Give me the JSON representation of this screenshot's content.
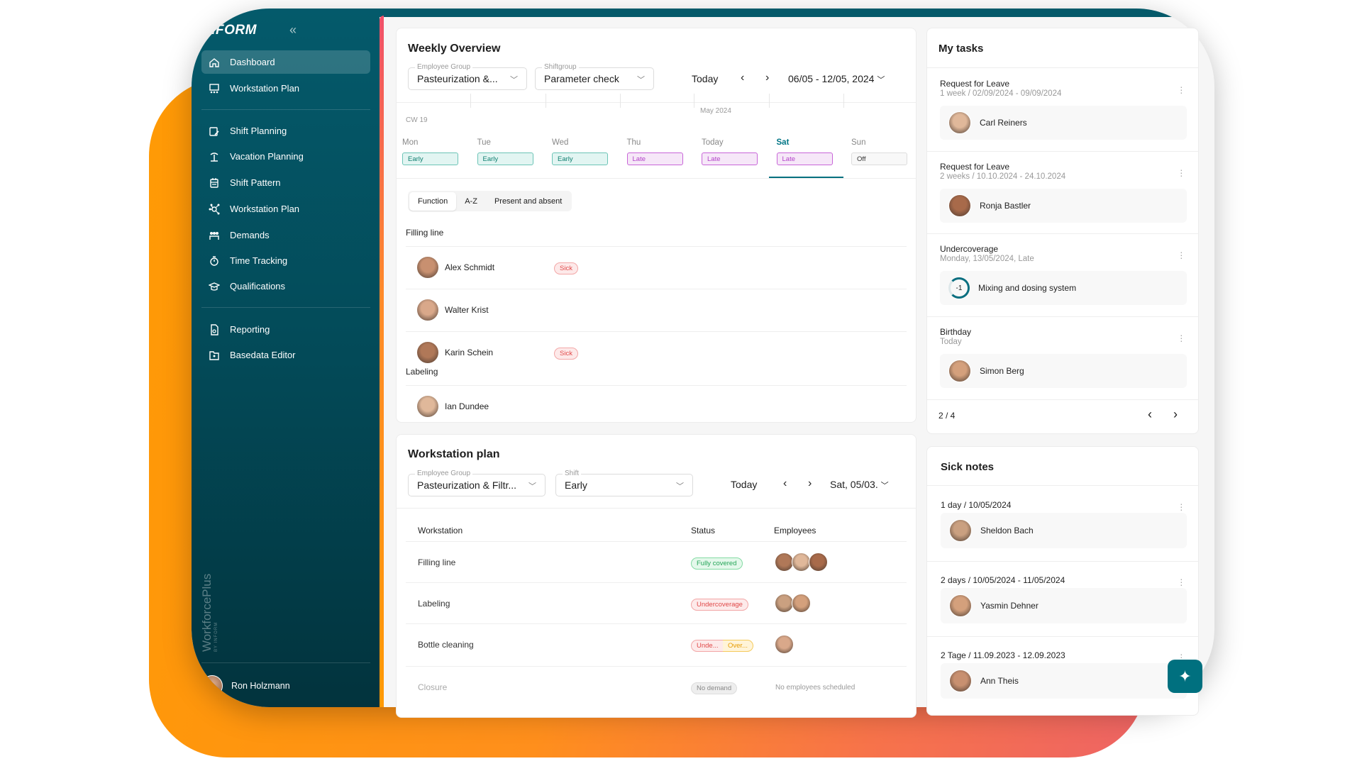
{
  "app": {
    "logo": "INFORM",
    "brand": "WorkforcePlus",
    "brand_sub": "BY INFORM"
  },
  "sidebar": {
    "items": [
      {
        "label": "Dashboard",
        "icon": "home-icon",
        "active": true
      },
      {
        "label": "Workstation Plan",
        "icon": "workstation-icon"
      },
      {
        "label": "Shift Planning",
        "icon": "calendar-edit-icon"
      },
      {
        "label": "Vacation Planning",
        "icon": "palm-tree-icon"
      },
      {
        "label": "Shift Pattern",
        "icon": "calendar-icon"
      },
      {
        "label": "Workstation Plan",
        "icon": "network-icon"
      },
      {
        "label": "Demands",
        "icon": "people-icon"
      },
      {
        "label": "Time Tracking",
        "icon": "stopwatch-icon"
      },
      {
        "label": "Qualifications",
        "icon": "graduation-cap-icon"
      },
      {
        "label": "Reporting",
        "icon": "report-icon"
      },
      {
        "label": "Basedata Editor",
        "icon": "folder-icon"
      }
    ],
    "user": "Ron Holzmann"
  },
  "weekly": {
    "title": "Weekly Overview",
    "employee_group": {
      "label": "Employee Group",
      "value": "Pasteurization &..."
    },
    "shiftgroup": {
      "label": "Shiftgroup",
      "value": "Parameter check"
    },
    "today": "Today",
    "range": "06/05 - 12/05, 2024",
    "cw": "CW 19",
    "month": "May 2024",
    "days": [
      {
        "name": "Mon",
        "shift": "Early",
        "type": "early"
      },
      {
        "name": "Tue",
        "shift": "Early",
        "type": "early"
      },
      {
        "name": "Wed",
        "shift": "Early",
        "type": "early"
      },
      {
        "name": "Thu",
        "shift": "Late",
        "type": "late"
      },
      {
        "name": "Today",
        "shift": "Late",
        "type": "late"
      },
      {
        "name": "Sat",
        "shift": "Late",
        "type": "late",
        "selected": true
      },
      {
        "name": "Sun",
        "shift": "Off",
        "type": "off"
      }
    ],
    "sort": [
      "Function",
      "A-Z",
      "Present and absent"
    ],
    "sections": [
      {
        "name": "Filling line",
        "people": [
          {
            "name": "Alex Schmidt",
            "badge": "Sick"
          },
          {
            "name": "Walter Krist"
          },
          {
            "name": "Karin Schein",
            "badge": "Sick"
          }
        ]
      },
      {
        "name": "Labeling",
        "people": [
          {
            "name": "Ian Dundee"
          }
        ]
      }
    ]
  },
  "workstation": {
    "title": "Workstation plan",
    "employee_group": {
      "label": "Employee Group",
      "value": "Pasteurization & Filtr..."
    },
    "shift": {
      "label": "Shift",
      "value": "Early"
    },
    "today": "Today",
    "date": "Sat, 05/03.",
    "headers": [
      "Workstation",
      "Status",
      "Employees"
    ],
    "rows": [
      {
        "name": "Filling line",
        "status": [
          {
            "text": "Fully covered",
            "type": "full"
          }
        ],
        "employees": 3
      },
      {
        "name": "Labeling",
        "status": [
          {
            "text": "Undercoverage",
            "type": "under"
          }
        ],
        "employees": 2
      },
      {
        "name": "Bottle cleaning",
        "status": [
          {
            "text": "Unde...",
            "type": "under"
          },
          {
            "text": "Over...",
            "type": "over"
          }
        ],
        "employees": 1
      },
      {
        "name": "Closure",
        "status": [
          {
            "text": "No demand",
            "type": "nod"
          }
        ],
        "employees": 0,
        "note": "No employees scheduled"
      }
    ]
  },
  "tasks": {
    "title": "My tasks",
    "items": [
      {
        "title": "Request for Leave",
        "sub": "1 week / 02/09/2024 - 09/09/2024",
        "person": "Carl Reiners"
      },
      {
        "title": "Request for Leave",
        "sub": "2 weeks / 10.10.2024 - 24.10.2024",
        "person": "Ronja Bastler"
      },
      {
        "title": "Undercoverage",
        "sub": "Monday, 13/05/2024, Late",
        "person": "Mixing and dosing system",
        "gauge": "-1"
      },
      {
        "title": "Birthday",
        "sub": "Today",
        "person": "Simon Berg"
      }
    ],
    "pager": "2 / 4"
  },
  "sick": {
    "title": "Sick notes",
    "items": [
      {
        "title": "1 day / 10/05/2024",
        "person": "Sheldon Bach"
      },
      {
        "title": "2 days / 10/05/2024 - 11/05/2024",
        "person": "Yasmin Dehner"
      },
      {
        "title": "2 Tage / 11.09.2023 - 12.09.2023",
        "person": "Ann Theis"
      }
    ]
  },
  "colors": {
    "sidebar": "#045a6b",
    "accent": "#00707f",
    "early": "#0f7f70",
    "late": "#b243c8",
    "sick": "#e14a4a"
  }
}
